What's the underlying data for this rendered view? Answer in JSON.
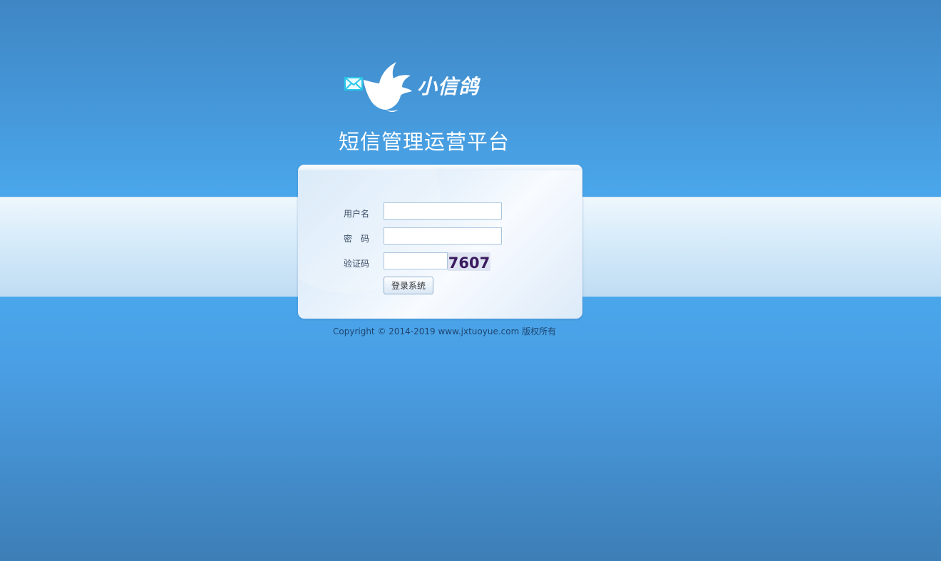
{
  "brand": {
    "logo_text": "小信鸽",
    "title": "短信管理运营平台"
  },
  "login": {
    "username_label": "用户名",
    "username_value": "",
    "password_label": "密　码",
    "password_value": "",
    "captcha_label": "验证码",
    "captcha_value": "",
    "captcha_code": "7607",
    "submit_label": "登录系统"
  },
  "footer": {
    "copyright": "Copyright © 2014-2019 www.jxtuoyue.com 版权所有"
  },
  "colors": {
    "background_top": "#3f86c4",
    "background_mid": "#4aa6ea",
    "band": "#d6ebfa",
    "captcha_text": "#3a1a5e"
  },
  "icons": [
    "envelope-icon",
    "dove-logo"
  ]
}
